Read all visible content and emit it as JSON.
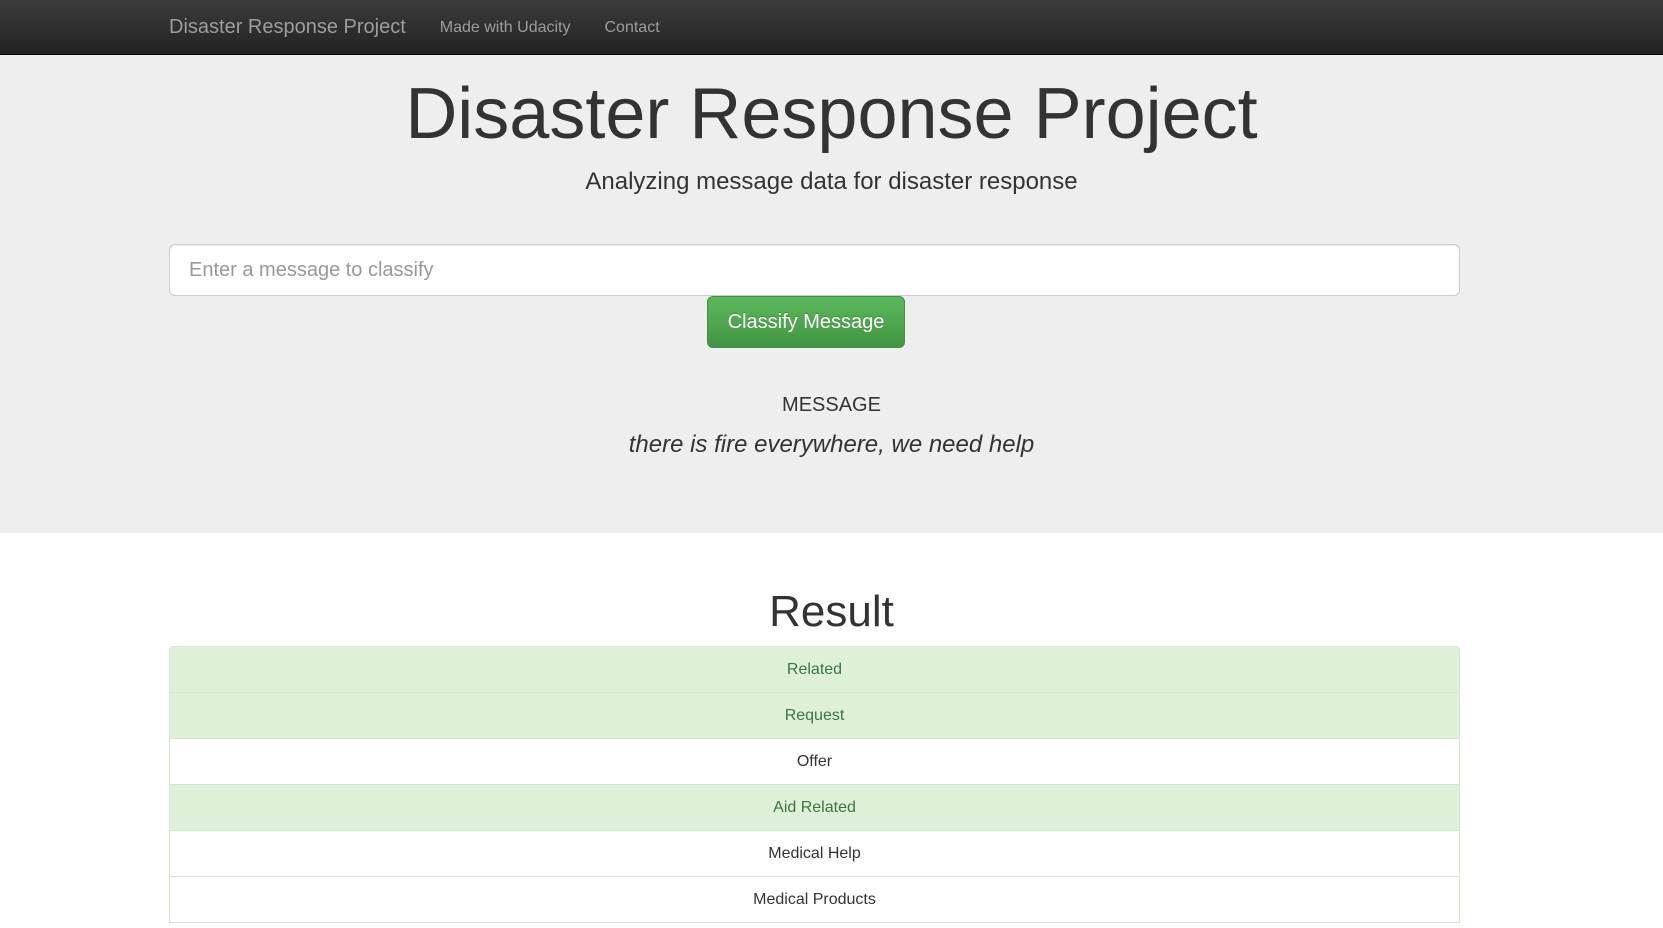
{
  "navbar": {
    "brand": "Disaster Response Project",
    "links": [
      "Made with Udacity",
      "Contact"
    ]
  },
  "jumbotron": {
    "title": "Disaster Response Project",
    "subtitle": "Analyzing message data for disaster response",
    "input_placeholder": "Enter a message to classify",
    "button_label": "Classify Message",
    "message_heading": "MESSAGE",
    "message_text": "there is fire everywhere, we need help"
  },
  "result": {
    "title": "Result",
    "items": [
      {
        "label": "Related",
        "positive": true
      },
      {
        "label": "Request",
        "positive": true
      },
      {
        "label": "Offer",
        "positive": false
      },
      {
        "label": "Aid Related",
        "positive": true
      },
      {
        "label": "Medical Help",
        "positive": false
      },
      {
        "label": "Medical Products",
        "positive": false
      }
    ]
  },
  "colors": {
    "positive_bg": "#dff0d8",
    "positive_text": "#3c763d",
    "button": "#5cb85c",
    "navbar": "#222222",
    "jumbotron_bg": "#eeeeee"
  }
}
